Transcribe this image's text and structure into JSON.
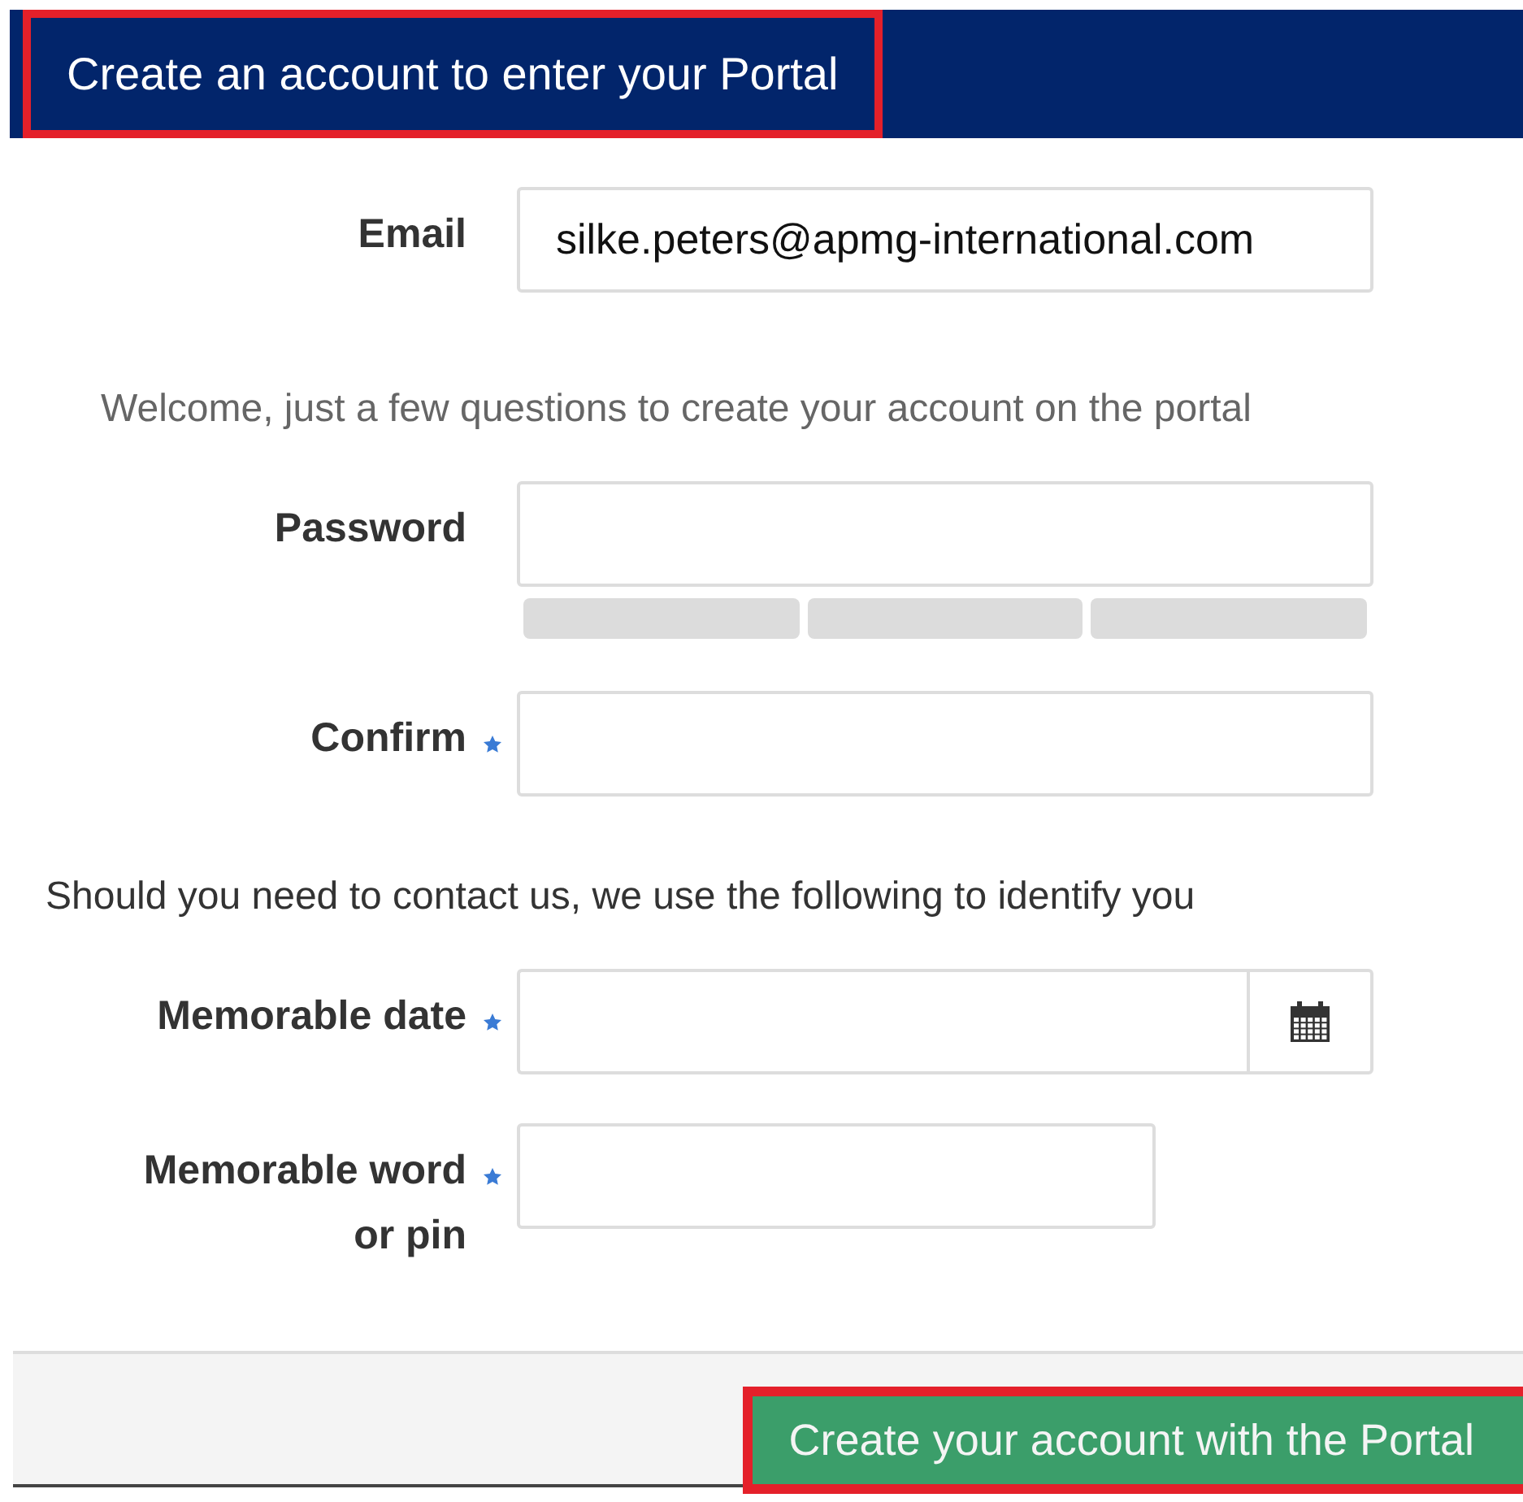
{
  "header": {
    "title": "Create an account to enter your Portal",
    "highlighted": true
  },
  "form": [
    {
      "kind": "text",
      "label": "Email",
      "required": false,
      "value": "silke.peters@apmg-international.com"
    },
    {
      "kind": "note",
      "text": "Welcome, just a few questions to create your account on the portal"
    },
    {
      "kind": "password",
      "label": "Password",
      "required": false
    },
    {
      "kind": "text",
      "label": "Confirm",
      "required": true
    },
    {
      "kind": "note",
      "text": "Should you need to contact us, we use the following to identify you"
    },
    {
      "kind": "date",
      "label": "Memorable date",
      "required": true
    },
    {
      "kind": "short",
      "label": "Memorable word or pin",
      "required": true
    }
  ],
  "footer": {
    "button": {
      "label": "Create your account with the Portal",
      "highlighted": true
    }
  }
}
